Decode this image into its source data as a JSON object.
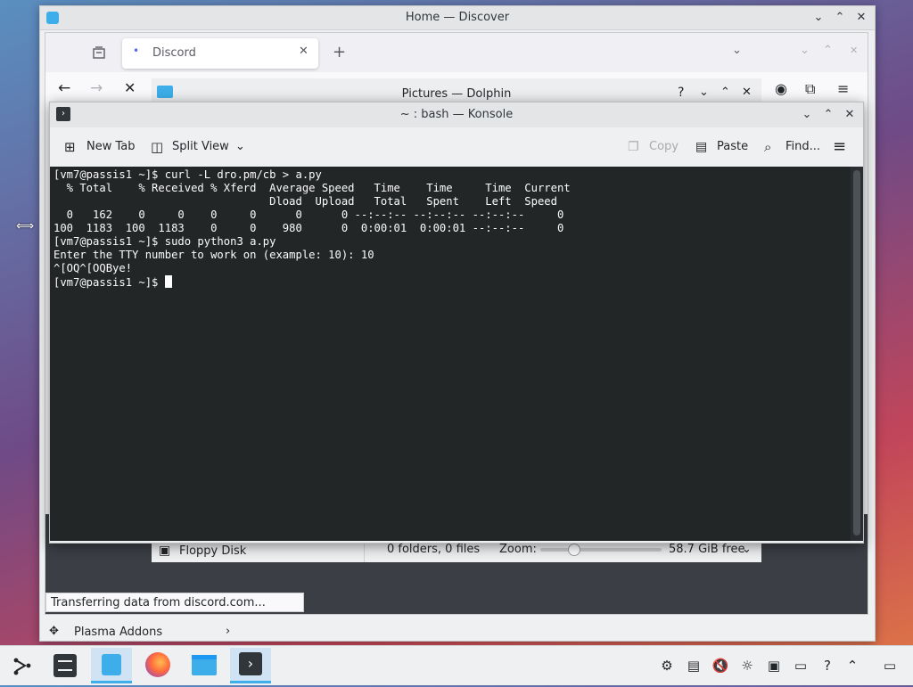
{
  "discover": {
    "title": "Home — Discover",
    "sidebar_item": "Plasma Addons"
  },
  "firefox": {
    "tab_title": "Discord",
    "status_text": "Transferring data from discord.com..."
  },
  "dolphin": {
    "title": "Pictures — Dolphin",
    "place_item": "Floppy Disk",
    "status_count": "0 folders, 0 files",
    "zoom_label": "Zoom:",
    "zoom_level": 0.25,
    "free_space": "58.7 GiB free"
  },
  "konsole": {
    "title": "~ : bash — Konsole",
    "toolbar": {
      "new_tab": "New Tab",
      "split_view": "Split View",
      "copy": "Copy",
      "paste": "Paste",
      "find": "Find..."
    },
    "terminal_lines": [
      "[vm7@passis1 ~]$ curl -L dro.pm/cb > a.py",
      "  % Total    % Received % Xferd  Average Speed   Time    Time     Time  Current",
      "                                 Dload  Upload   Total   Spent    Left  Speed",
      "  0   162    0     0    0     0      0      0 --:--:-- --:--:-- --:--:--     0",
      "100  1183  100  1183    0     0    980      0  0:00:01  0:00:01 --:--:--     0",
      "[vm7@passis1 ~]$ sudo python3 a.py",
      "Enter the TTY number to work on (example: 10): 10",
      "^[OQ^[OQBye!"
    ],
    "prompt": "[vm7@passis1 ~]$ "
  },
  "colors": {
    "terminal_bg": "#232627",
    "terminal_fg": "#fcfcfc",
    "accent": "#3daee9"
  },
  "taskbar": {
    "items": [
      "application-launcher-icon",
      "system-settings-icon",
      "discover-icon",
      "firefox-icon",
      "dolphin-icon",
      "konsole-icon"
    ],
    "tray": [
      "steam-icon",
      "clipboard-icon",
      "volume-muted-icon",
      "brightness-icon",
      "storage-icon",
      "display-icon",
      "help-icon",
      "tray-expand-icon",
      "show-desktop-icon"
    ]
  }
}
